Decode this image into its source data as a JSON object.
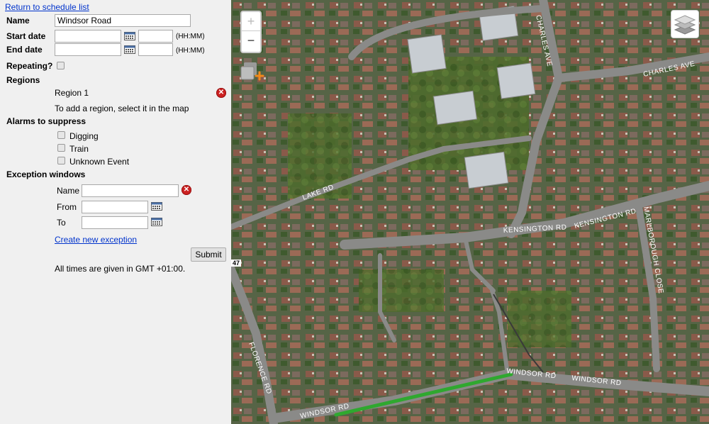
{
  "nav": {
    "return_link": "Return to schedule list"
  },
  "form": {
    "name_label": "Name",
    "name_value": "Windsor Road",
    "start_date_label": "Start date",
    "end_date_label": "End date",
    "time_hint": "(HH:MM)",
    "repeating_label": "Repeating?",
    "regions_label": "Regions",
    "region_name": "Region 1",
    "region_hint": "To add a region, select it in the map",
    "alarms_label": "Alarms to suppress",
    "alarms": [
      "Digging",
      "Train",
      "Unknown Event"
    ],
    "exceptions_label": "Exception windows",
    "exception_name_label": "Name",
    "exception_from_label": "From",
    "exception_to_label": "To",
    "create_exception_link": "Create new exception",
    "submit_label": "Submit",
    "timezone_note": "All times are given in GMT +01:00."
  },
  "map": {
    "zoom_in": "+",
    "zoom_out": "−",
    "scale_marker": "47",
    "roads": {
      "charles_ave_1": "CHARLES AVE",
      "charles_ave_2": "CHARLES AVE",
      "lake_rd": "LAKE RD",
      "kensington_rd_1": "KENSINGTON RD",
      "kensington_rd_2": "KENSINGTON RD",
      "marlborough_close": "MARLBOROUGH CLOSE",
      "florence_rd": "FLORENCE RD",
      "windsor_rd_1": "WINDSOR RD",
      "windsor_rd_2": "WINDSOR RD",
      "windsor_rd_3": "WINDSOR RD"
    },
    "colors": {
      "selected_region": "#2fa82f",
      "road": "#8a8a88"
    }
  }
}
